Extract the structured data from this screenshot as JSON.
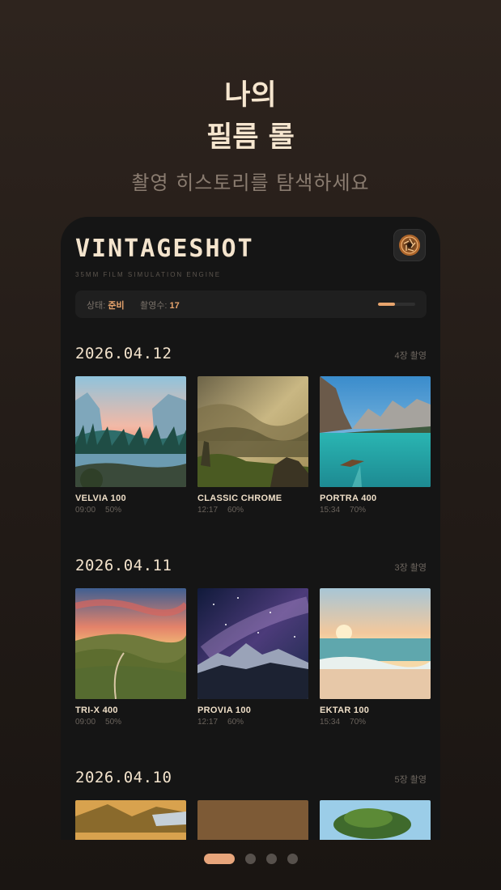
{
  "hero": {
    "title_line1": "나의",
    "title_line2": "필름 롤",
    "subtitle": "촬영 히스토리를 탐색하세요"
  },
  "app": {
    "brand": "VINTAGESHOT",
    "tagline": "35MM FILM SIMULATION ENGINE",
    "status": {
      "state_label": "상태:",
      "state_value": "준비",
      "shots_label": "촬영수:",
      "shots_value": "17",
      "progress": 0.45
    }
  },
  "sections": [
    {
      "date": "2026.04.12",
      "count": "4장 촬영",
      "photos": [
        {
          "film": "VELVIA 100",
          "time": "09:00",
          "pct": "50%"
        },
        {
          "film": "CLASSIC CHROME",
          "time": "12:17",
          "pct": "60%"
        },
        {
          "film": "PORTRA 400",
          "time": "15:34",
          "pct": "70%"
        }
      ]
    },
    {
      "date": "2026.04.11",
      "count": "3장 촬영",
      "photos": [
        {
          "film": "TRI-X 400",
          "time": "09:00",
          "pct": "50%"
        },
        {
          "film": "PROVIA 100",
          "time": "12:17",
          "pct": "60%"
        },
        {
          "film": "EKTAR 100",
          "time": "15:34",
          "pct": "70%"
        }
      ]
    },
    {
      "date": "2026.04.10",
      "count": "5장 촬영",
      "photos": []
    }
  ],
  "pager": {
    "pages": 4,
    "active": 0
  },
  "colors": {
    "accent": "#e7a46d",
    "background": "#221b17",
    "card": "#151515"
  }
}
